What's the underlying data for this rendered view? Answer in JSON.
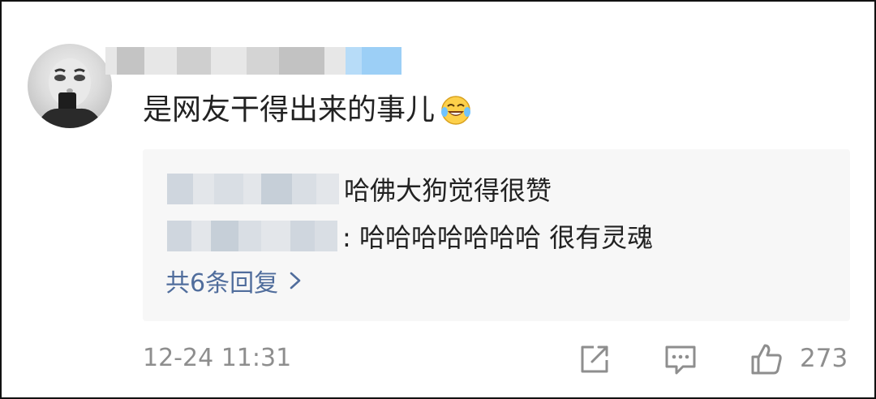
{
  "comment": {
    "avatar_icon": "user-avatar-icon",
    "text": "是网友干得出来的事儿",
    "emoji": "laughing-tears-emoji"
  },
  "replies": [
    {
      "text": "哈佛大狗觉得很赞"
    },
    {
      "text": ": 哈哈哈哈哈哈哈 很有灵魂"
    }
  ],
  "more_replies": {
    "label": "共6条回复",
    "icon": "chevron-right-icon"
  },
  "footer": {
    "timestamp": "12-24 11:31",
    "share_icon": "share-icon",
    "comment_icon": "comment-icon",
    "like_icon": "thumbs-up-icon",
    "like_count": "273"
  },
  "colors": {
    "link": "#506d9c",
    "meta": "#8e8e8e",
    "reply_bg": "#f7f7f7"
  }
}
